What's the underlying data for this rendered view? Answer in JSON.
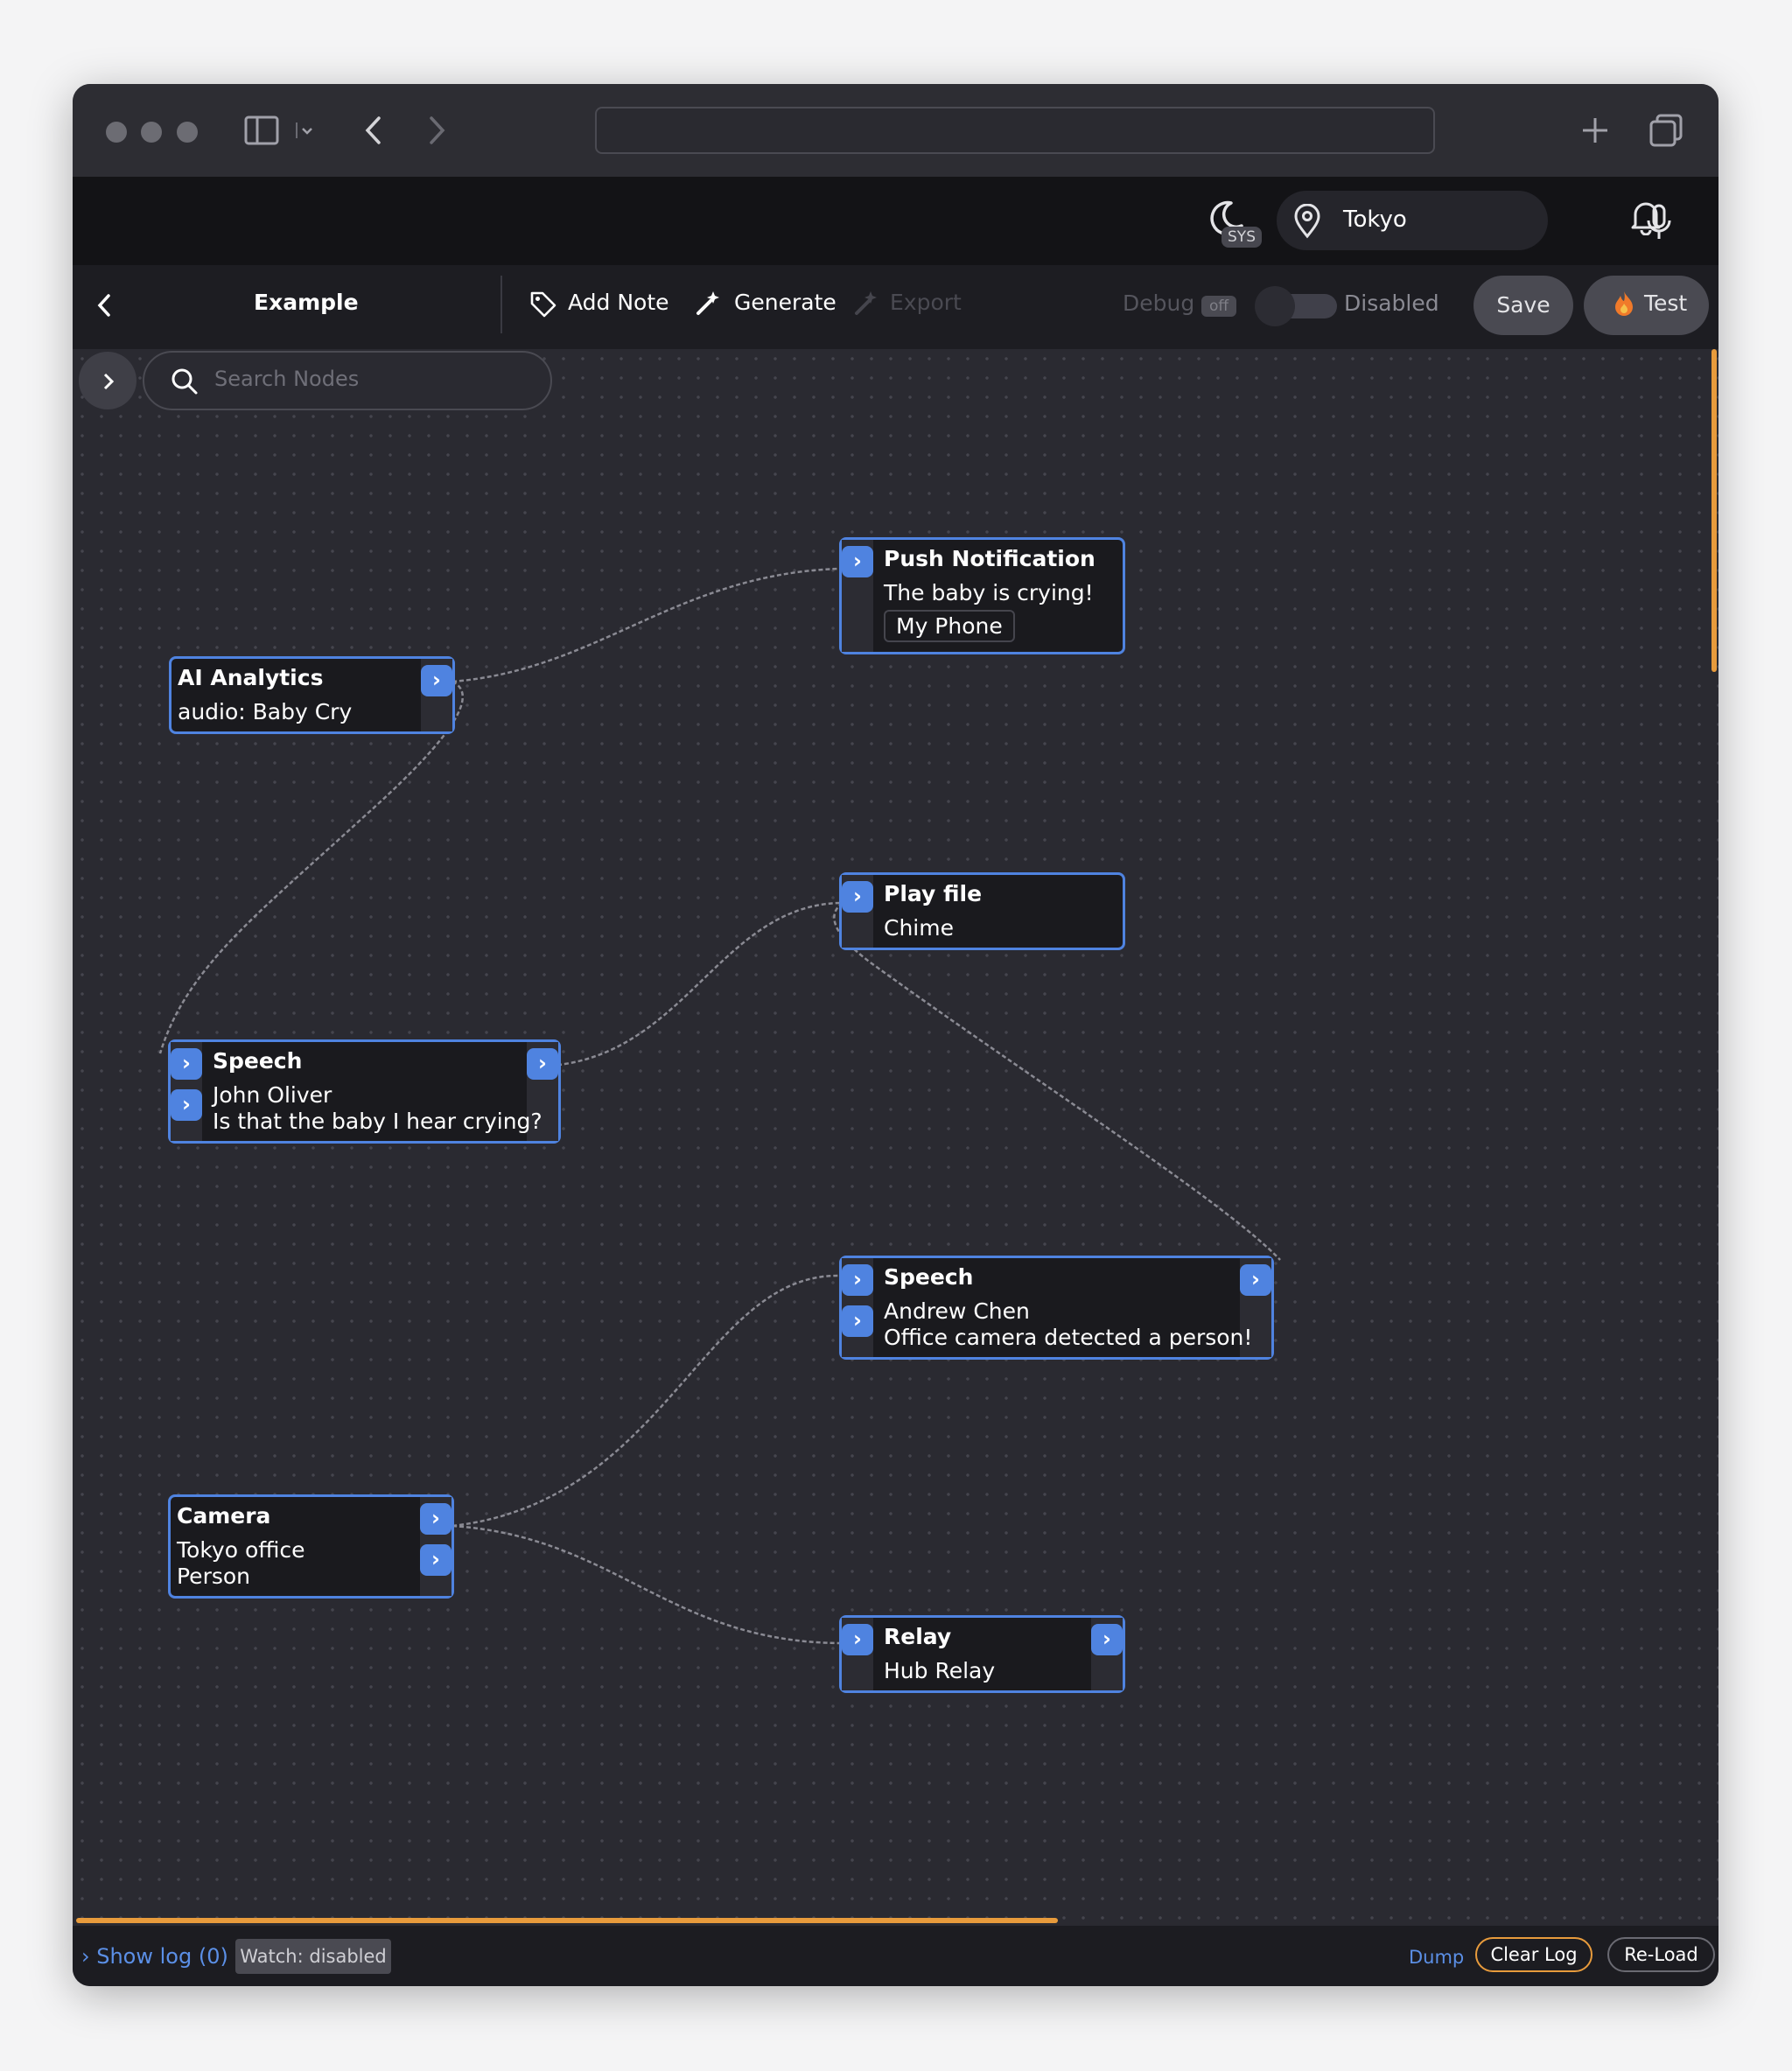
{
  "browser": {
    "url": "",
    "icons": [
      "sidebar-icon",
      "chevron-down-icon",
      "back-arrow-icon",
      "forward-arrow-icon",
      "new-tab-icon",
      "tabs-overview-icon"
    ]
  },
  "appbar": {
    "theme_badge": "SYS",
    "location": "Tokyo",
    "icons": [
      "moon-icon",
      "location-pin-icon",
      "dropdown-caret-icon",
      "microphone-icon",
      "bell-icon"
    ]
  },
  "toolbar": {
    "title": "Example",
    "add_note": "Add Note",
    "generate": "Generate",
    "export": "Export",
    "debug": "Debug",
    "debug_state": "off",
    "enabled_state": "Disabled",
    "save": "Save",
    "test": "Test"
  },
  "canvas": {
    "search_placeholder": "Search Nodes"
  },
  "nodes": {
    "push": {
      "title": "Push Notification",
      "line1": "The baby is crying!",
      "chip": "My Phone"
    },
    "ai": {
      "title": "AI Analytics",
      "line1": "audio: Baby Cry"
    },
    "play": {
      "title": "Play file",
      "line1": "Chime"
    },
    "speech1": {
      "title": "Speech",
      "line1": "John Oliver",
      "line2": "Is that the baby I hear crying?"
    },
    "speech2": {
      "title": "Speech",
      "line1": "Andrew Chen",
      "line2": "Office camera detected a person!"
    },
    "camera": {
      "title": "Camera",
      "line1": "Tokyo office",
      "line2": "Person"
    },
    "relay": {
      "title": "Relay",
      "line1": "Hub Relay"
    }
  },
  "port_glyph": "›",
  "log": {
    "show_log": "› Show log (0)",
    "watch": "Watch: disabled",
    "dump": "Dump",
    "clear": "Clear Log",
    "reload": "Re-Load"
  },
  "colors": {
    "accent": "#4f83e0",
    "canvas_bg": "#2a2a31",
    "node_bg": "#1a1a1e",
    "scroll_accent": "#e89b3c",
    "wire": "#8a8a93"
  }
}
